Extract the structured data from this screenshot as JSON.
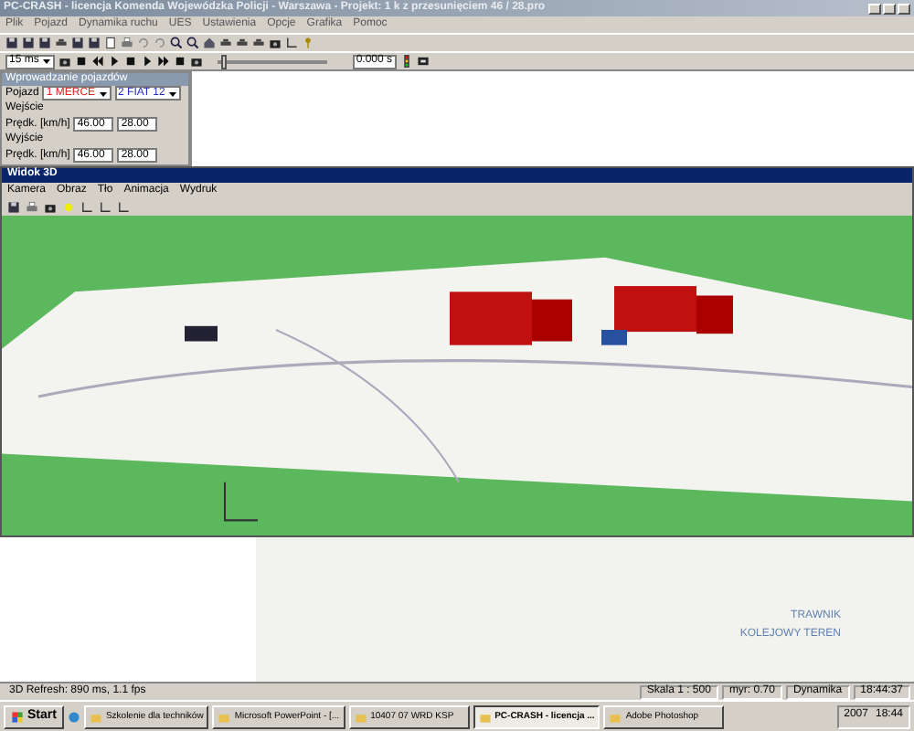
{
  "window": {
    "title": "PC-CRASH - licencja Komenda Wojewódzka Policji - Warszawa - Projekt: 1 k z przesunięciem 46 / 28.pro"
  },
  "menu": [
    "Plik",
    "Pojazd",
    "Dynamika ruchu",
    "UES",
    "Ustawienia",
    "Opcje",
    "Grafika",
    "Pomoc"
  ],
  "playback": {
    "interval": "15 ms",
    "time": "0.000 s",
    "level": 0.04
  },
  "vehicle_panel": {
    "title": "Wprowadzanie pojazdów",
    "vehicle_label": "Pojazd",
    "vehicles": [
      {
        "name": "1 MERCE",
        "color": "#e02020"
      },
      {
        "name": "2 FIAT 12",
        "color": "#2030c0"
      }
    ],
    "entry_label": "Wejście",
    "entry_speed_label": "Prędk. [km/h]",
    "entry_speeds": [
      "46.00",
      "28.00"
    ],
    "exit_label": "Wyjście",
    "exit_speed_label": "Prędk. [km/h]",
    "exit_speeds": [
      "46.00",
      "28.00"
    ]
  },
  "view_3d": {
    "title": "Widok 3D",
    "menu": [
      "Kamera",
      "Obraz",
      "Tło",
      "Animacja",
      "Wydruk"
    ]
  },
  "plan": {
    "labels": [
      "TRAWNIK",
      "KOLEJOWY TEREN"
    ]
  },
  "status_bar": [
    "3D Refresh: 890 ms, 1.1 fps",
    "Skala 1 : 500",
    "myr: 0.70",
    "Dynamika",
    "18:44:37"
  ],
  "taskbar": {
    "start": "Start",
    "tasks": [
      {
        "label": "Szkolenie dla techników",
        "selected": false
      },
      {
        "label": "Microsoft PowerPoint - [...",
        "selected": false
      },
      {
        "label": "10407 07 WRD KSP",
        "selected": false
      },
      {
        "label": "PC-CRASH - licencja ...",
        "selected": true
      },
      {
        "label": "Adobe Photoshop",
        "selected": false
      }
    ],
    "tray": [
      "2007",
      "18:44"
    ]
  }
}
